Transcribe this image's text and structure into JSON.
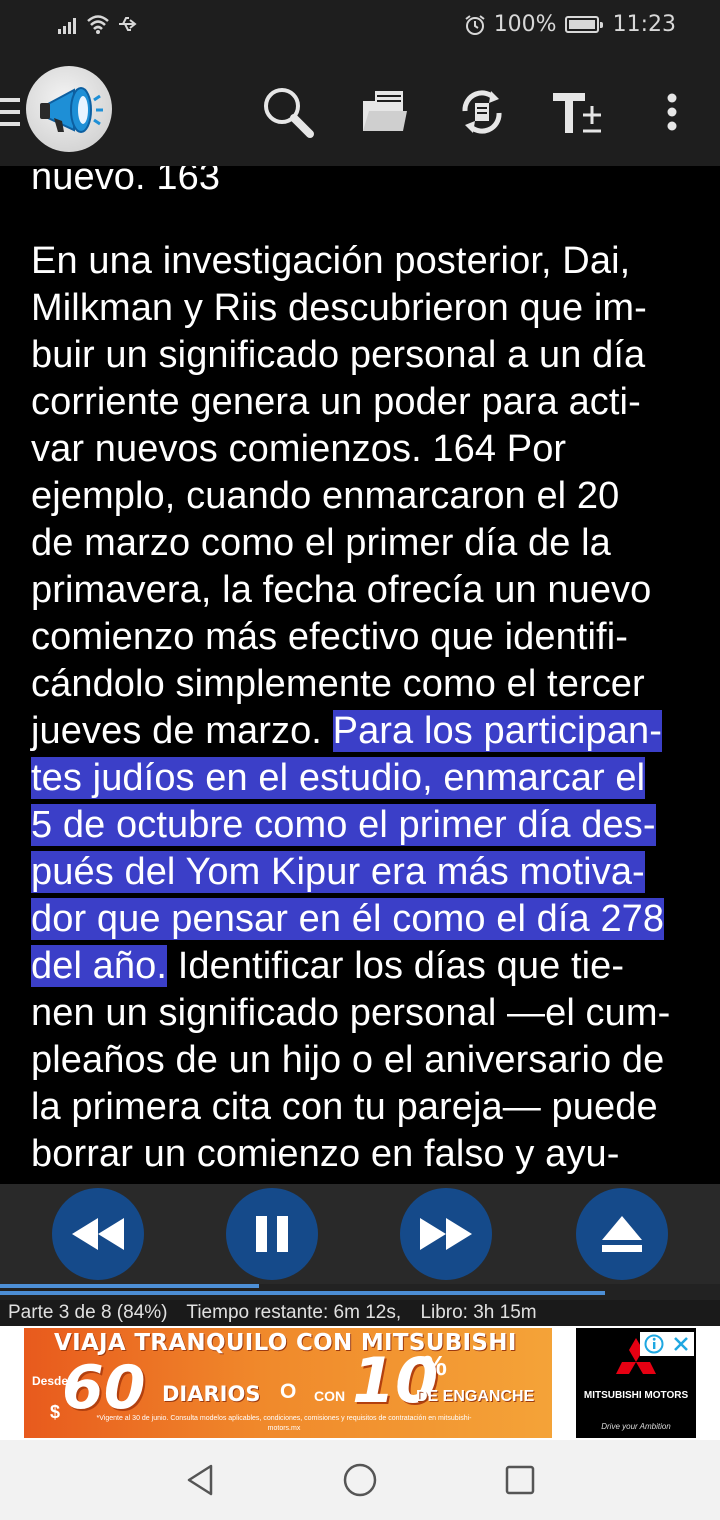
{
  "status_bar": {
    "battery_percent": "100%",
    "time": "11:23"
  },
  "toolbar": {
    "icons": [
      "menu-icon",
      "megaphone-logo",
      "search-icon",
      "folder-icon",
      "sync-icon",
      "text-size-icon",
      "more-vert-icon"
    ]
  },
  "reader": {
    "paragraph_0": "nuevo. 163",
    "paragraph_1_before": "En una investigación posterior, Dai,\nMilkman y Riis descubrieron que im-\nbuir un significado personal a un día\ncorriente genera un poder para acti-\nvar nuevos comienzos. 164 Por\nejemplo, cuando enmarcaron el 20\nde marzo como el primer día de la\nprimavera, la fecha ofrecía un nuevo\ncomienzo más efectivo que identifi-\ncándolo simplemente como el tercer\njueves de marzo. ",
    "paragraph_1_highlight": "Para los participan-\ntes judíos en el estudio, enmarcar el\n5 de octubre como el primer día des-\npués del Yom Kipur era más motiva-\ndor que pensar en él como el día 278\ndel año.",
    "paragraph_1_after": " Identificar los días que tie-\nnen un significado personal —el cum-\npleaños de un hijo o el aniversario de\nla primera cita con tu pareja— puede\nborrar un comienzo en falso y ayu-",
    "highlight_color": "#3b3fc8"
  },
  "player": {
    "buttons": [
      "rewind-icon",
      "pause-icon",
      "fast-forward-icon",
      "eject-icon"
    ],
    "button_color": "#154a8a",
    "progress_part": 0.36,
    "progress_overall": 0.84
  },
  "info": {
    "part": "Parte 3 de 8 (84%)",
    "remaining": "Tiempo restante: 6m 12s,",
    "book": "Libro: 3h 15m"
  },
  "ad": {
    "headline": "VIAJA TRANQUILO CON MITSUBISHI",
    "desde": "Desde",
    "dollar": "$",
    "amount": "60",
    "diarios": "DIARIOS",
    "o": "O",
    "con": "CON",
    "percent_value": "10",
    "percent_sign": "%",
    "enganche": "DE ENGANCHE",
    "fine_print": "*Vigente al 30 de junio. Consulta modelos aplicables, condiciones, comisiones y requisitos de contratación en mitsubishi-motors.mx",
    "brand_name": "MITSUBISHI MOTORS",
    "brand_tagline": "Drive your Ambition"
  },
  "navbar": {
    "buttons": [
      "back-icon",
      "home-icon",
      "recents-icon"
    ]
  }
}
